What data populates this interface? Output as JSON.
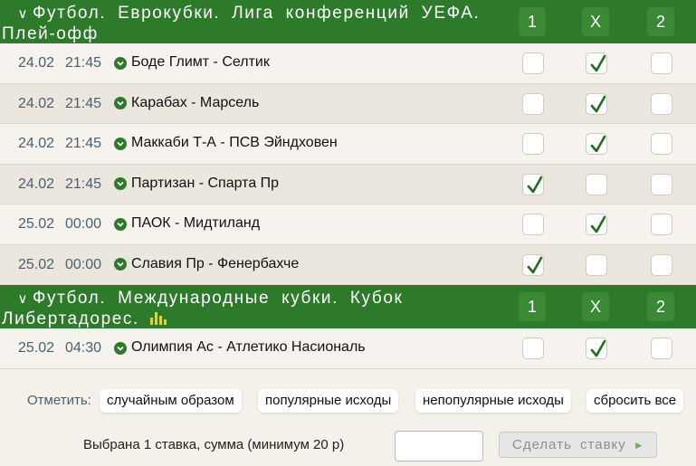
{
  "sections": [
    {
      "title": "Футбол. Еврокубки. Лига конференций УЕФА. Плей-офф",
      "columns": [
        "1",
        "X",
        "2"
      ],
      "has_stats_icon": false,
      "matches": [
        {
          "date": "24.02",
          "time": "21:45",
          "name": "Боде Глимт - Селтик",
          "checked": "X"
        },
        {
          "date": "24.02",
          "time": "21:45",
          "name": "Карабах - Марсель",
          "checked": "X"
        },
        {
          "date": "24.02",
          "time": "21:45",
          "name": "Маккаби Т-А - ПСВ Эйндховен",
          "checked": "X"
        },
        {
          "date": "24.02",
          "time": "21:45",
          "name": "Партизан - Спарта Пр",
          "checked": "1"
        },
        {
          "date": "25.02",
          "time": "00:00",
          "name": "ПАОК - Мидтиланд",
          "checked": "X"
        },
        {
          "date": "25.02",
          "time": "00:00",
          "name": "Славия Пр - Фенербахче",
          "checked": "1"
        }
      ]
    },
    {
      "title": "Футбол. Международные кубки. Кубок Либертадорес.",
      "columns": [
        "1",
        "X",
        "2"
      ],
      "has_stats_icon": true,
      "matches": [
        {
          "date": "25.02",
          "time": "04:30",
          "name": "Олимпия Ас - Атлетико Насиональ",
          "checked": "X"
        }
      ]
    }
  ],
  "mark": {
    "label": "Отметить:",
    "options": [
      "случайным образом",
      "популярные исходы",
      "непопулярные исходы",
      "сбросить все"
    ]
  },
  "summary": {
    "text": "Выбрана 1 ставка, сумма (минимум 20 р)",
    "amount_value": "",
    "button_label": "Сделать ставку"
  },
  "colors": {
    "section_header": "#2e7a2b",
    "stats_icon": "#e5d22b",
    "check_mark": "#1f6e1f"
  },
  "icons": {
    "section_toggle": "chevron-down-icon",
    "match_toggle": "chevron-down-circle-icon",
    "stats": "bar-chart-icon",
    "bet_arrow": "chevron-right-icon",
    "check": "check-icon"
  }
}
